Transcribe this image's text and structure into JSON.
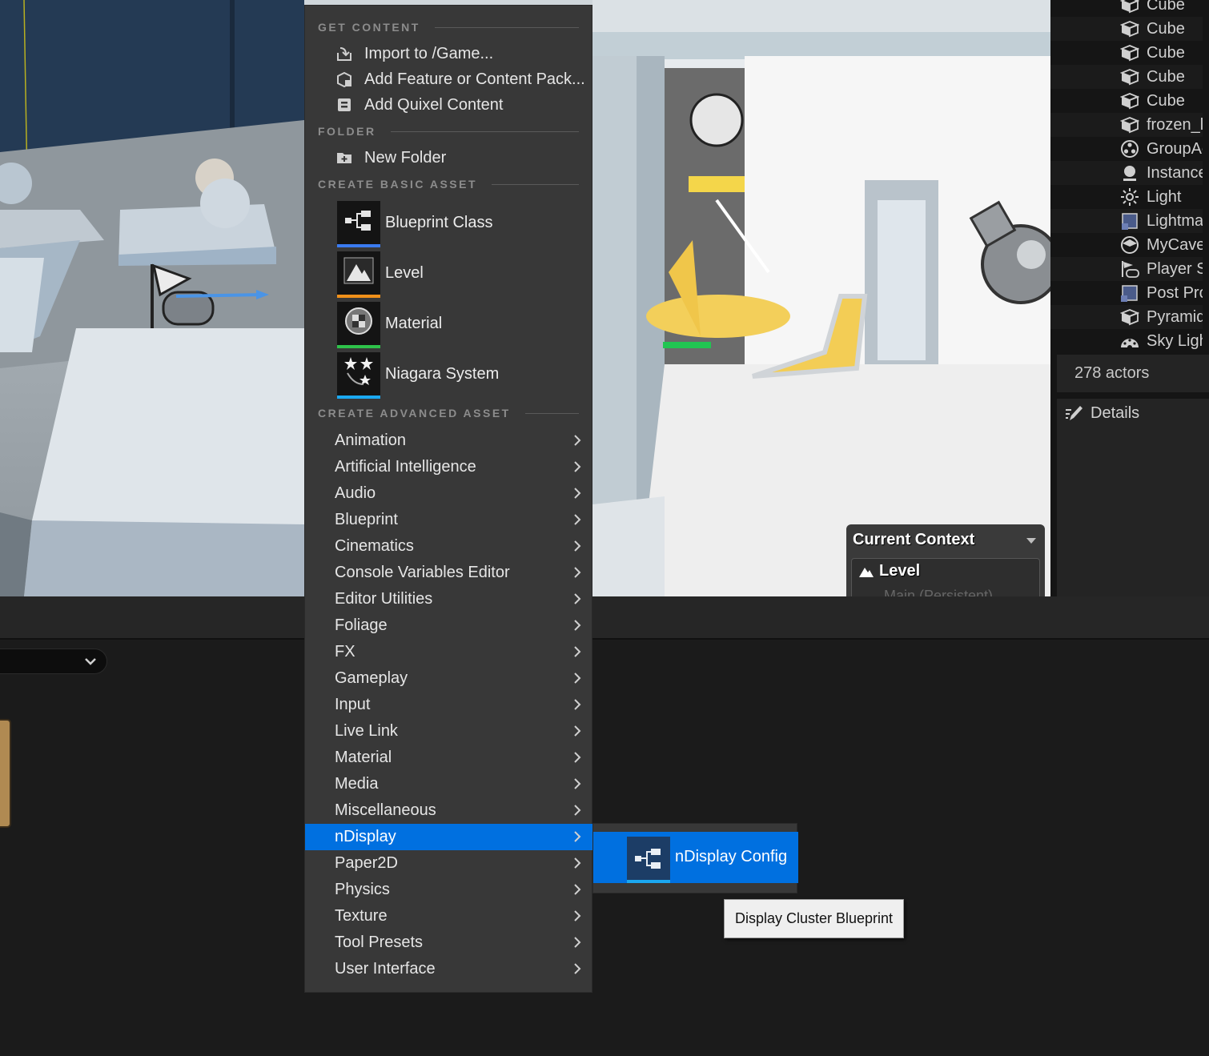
{
  "menu": {
    "sections": {
      "get_content": "GET CONTENT",
      "folder": "FOLDER",
      "basic": "CREATE BASIC ASSET",
      "advanced": "CREATE ADVANCED ASSET"
    },
    "get_content_items": [
      {
        "label": "Import to /Game...",
        "icon": "import-icon"
      },
      {
        "label": "Add Feature or Content Pack...",
        "icon": "content-pack-icon"
      },
      {
        "label": "Add Quixel Content",
        "icon": "quixel-icon"
      }
    ],
    "folder_items": [
      {
        "label": "New Folder",
        "icon": "new-folder-icon"
      }
    ],
    "basic_assets": [
      {
        "label": "Blueprint Class",
        "icon": "blueprint-icon",
        "color": "#3a7bf0"
      },
      {
        "label": "Level",
        "icon": "level-icon",
        "color": "#f0901a"
      },
      {
        "label": "Material",
        "icon": "material-icon",
        "color": "#2ec24a"
      },
      {
        "label": "Niagara System",
        "icon": "niagara-icon",
        "color": "#1ba8f0"
      }
    ],
    "advanced_items": [
      "Animation",
      "Artificial Intelligence",
      "Audio",
      "Blueprint",
      "Cinematics",
      "Console Variables Editor",
      "Editor Utilities",
      "Foliage",
      "FX",
      "Gameplay",
      "Input",
      "Live Link",
      "Material",
      "Media",
      "Miscellaneous",
      "nDisplay",
      "Paper2D",
      "Physics",
      "Texture",
      "Tool Presets",
      "User Interface"
    ],
    "selected_advanced": "nDisplay"
  },
  "submenu": {
    "item_label": "nDisplay Config",
    "icon": "blueprint-icon",
    "accent": "#1ba8f0"
  },
  "tooltip": "Display Cluster Blueprint",
  "outliner": {
    "rows": [
      {
        "label": "Cube",
        "icon": "cube-icon"
      },
      {
        "label": "Cube",
        "icon": "cube-icon"
      },
      {
        "label": "Cube",
        "icon": "cube-icon"
      },
      {
        "label": "Cube",
        "icon": "cube-icon"
      },
      {
        "label": "Cube",
        "icon": "cube-icon"
      },
      {
        "label": "frozen_l",
        "icon": "cube-icon"
      },
      {
        "label": "GroupAc",
        "icon": "group-icon"
      },
      {
        "label": "Instance",
        "icon": "instance-icon"
      },
      {
        "label": "Light",
        "icon": "light-icon"
      },
      {
        "label": "Lightma",
        "icon": "lightmass-icon"
      },
      {
        "label": "MyCave",
        "icon": "cave-icon"
      },
      {
        "label": "Player S",
        "icon": "player-start-icon"
      },
      {
        "label": "Post Pro",
        "icon": "post-process-icon"
      },
      {
        "label": "Pyramid",
        "icon": "cube-icon"
      },
      {
        "label": "Sky Ligh",
        "icon": "sky-light-icon"
      }
    ],
    "actor_count": "278 actors"
  },
  "details": {
    "tab_label": "Details"
  },
  "context": {
    "title": "Current Context",
    "level_label": "Level",
    "sub_label": "Main (Persistent)"
  },
  "colors": {
    "selection": "#0070e0",
    "menu_bg": "#383838"
  }
}
